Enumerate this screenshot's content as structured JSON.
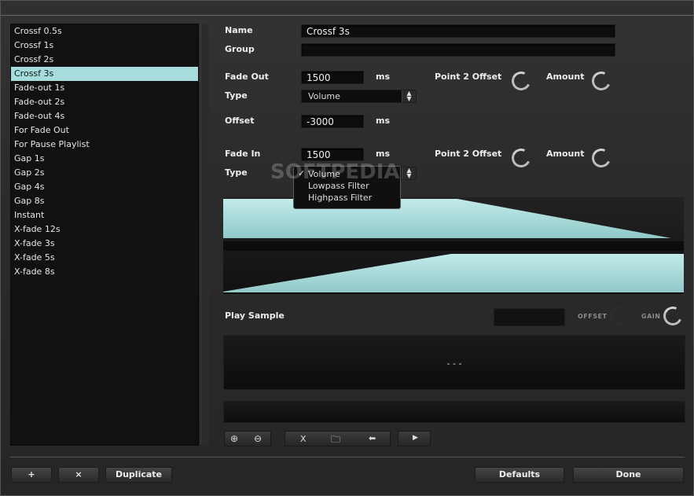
{
  "presets": [
    "Crossf 0.5s",
    "Crossf 1s",
    "Crossf 2s",
    "Crossf 3s",
    "Fade-out 1s",
    "Fade-out 2s",
    "Fade-out 4s",
    "For Fade Out",
    "For Pause Playlist",
    "Gap 1s",
    "Gap 2s",
    "Gap 4s",
    "Gap 8s",
    "Instant",
    "X-fade 12s",
    "X-fade 3s",
    "X-fade 5s",
    "X-fade 8s"
  ],
  "selected_preset": "Crossf 3s",
  "form": {
    "name_label": "Name",
    "name_value": "Crossf 3s",
    "group_label": "Group",
    "group_value": "",
    "fade_out_label": "Fade Out",
    "fade_out_value": "1500",
    "unit_ms": "ms",
    "type_label": "Type",
    "type_out_value": "Volume",
    "offset_label": "Offset",
    "offset_value": "-3000",
    "fade_in_label": "Fade In",
    "fade_in_value": "1500",
    "point2_offset_label": "Point 2 Offset",
    "amount_label": "Amount"
  },
  "type_dropdown": {
    "options": [
      "Volume",
      "Lowpass Filter",
      "Highpass Filter"
    ],
    "checked": "Volume"
  },
  "watermark": "SOFTPEDIA",
  "colors": {
    "accent": "#a8dcdc",
    "graph_fill": "#a9dada"
  },
  "sample": {
    "play_label": "Play Sample",
    "offset_label": "OFFSET",
    "gain_label": "GAIN",
    "time_display": "- - -"
  },
  "toolbar": {
    "zoom_in_icon": "zoom-in-icon",
    "zoom_out_icon": "zoom-out-icon",
    "clear_label": "X",
    "open_icon": "folder-icon",
    "load_icon": "load-icon",
    "play_icon": "play-icon"
  },
  "footer": {
    "add_label": "+",
    "remove_label": "×",
    "duplicate_label": "Duplicate",
    "defaults_label": "Defaults",
    "done_label": "Done"
  }
}
